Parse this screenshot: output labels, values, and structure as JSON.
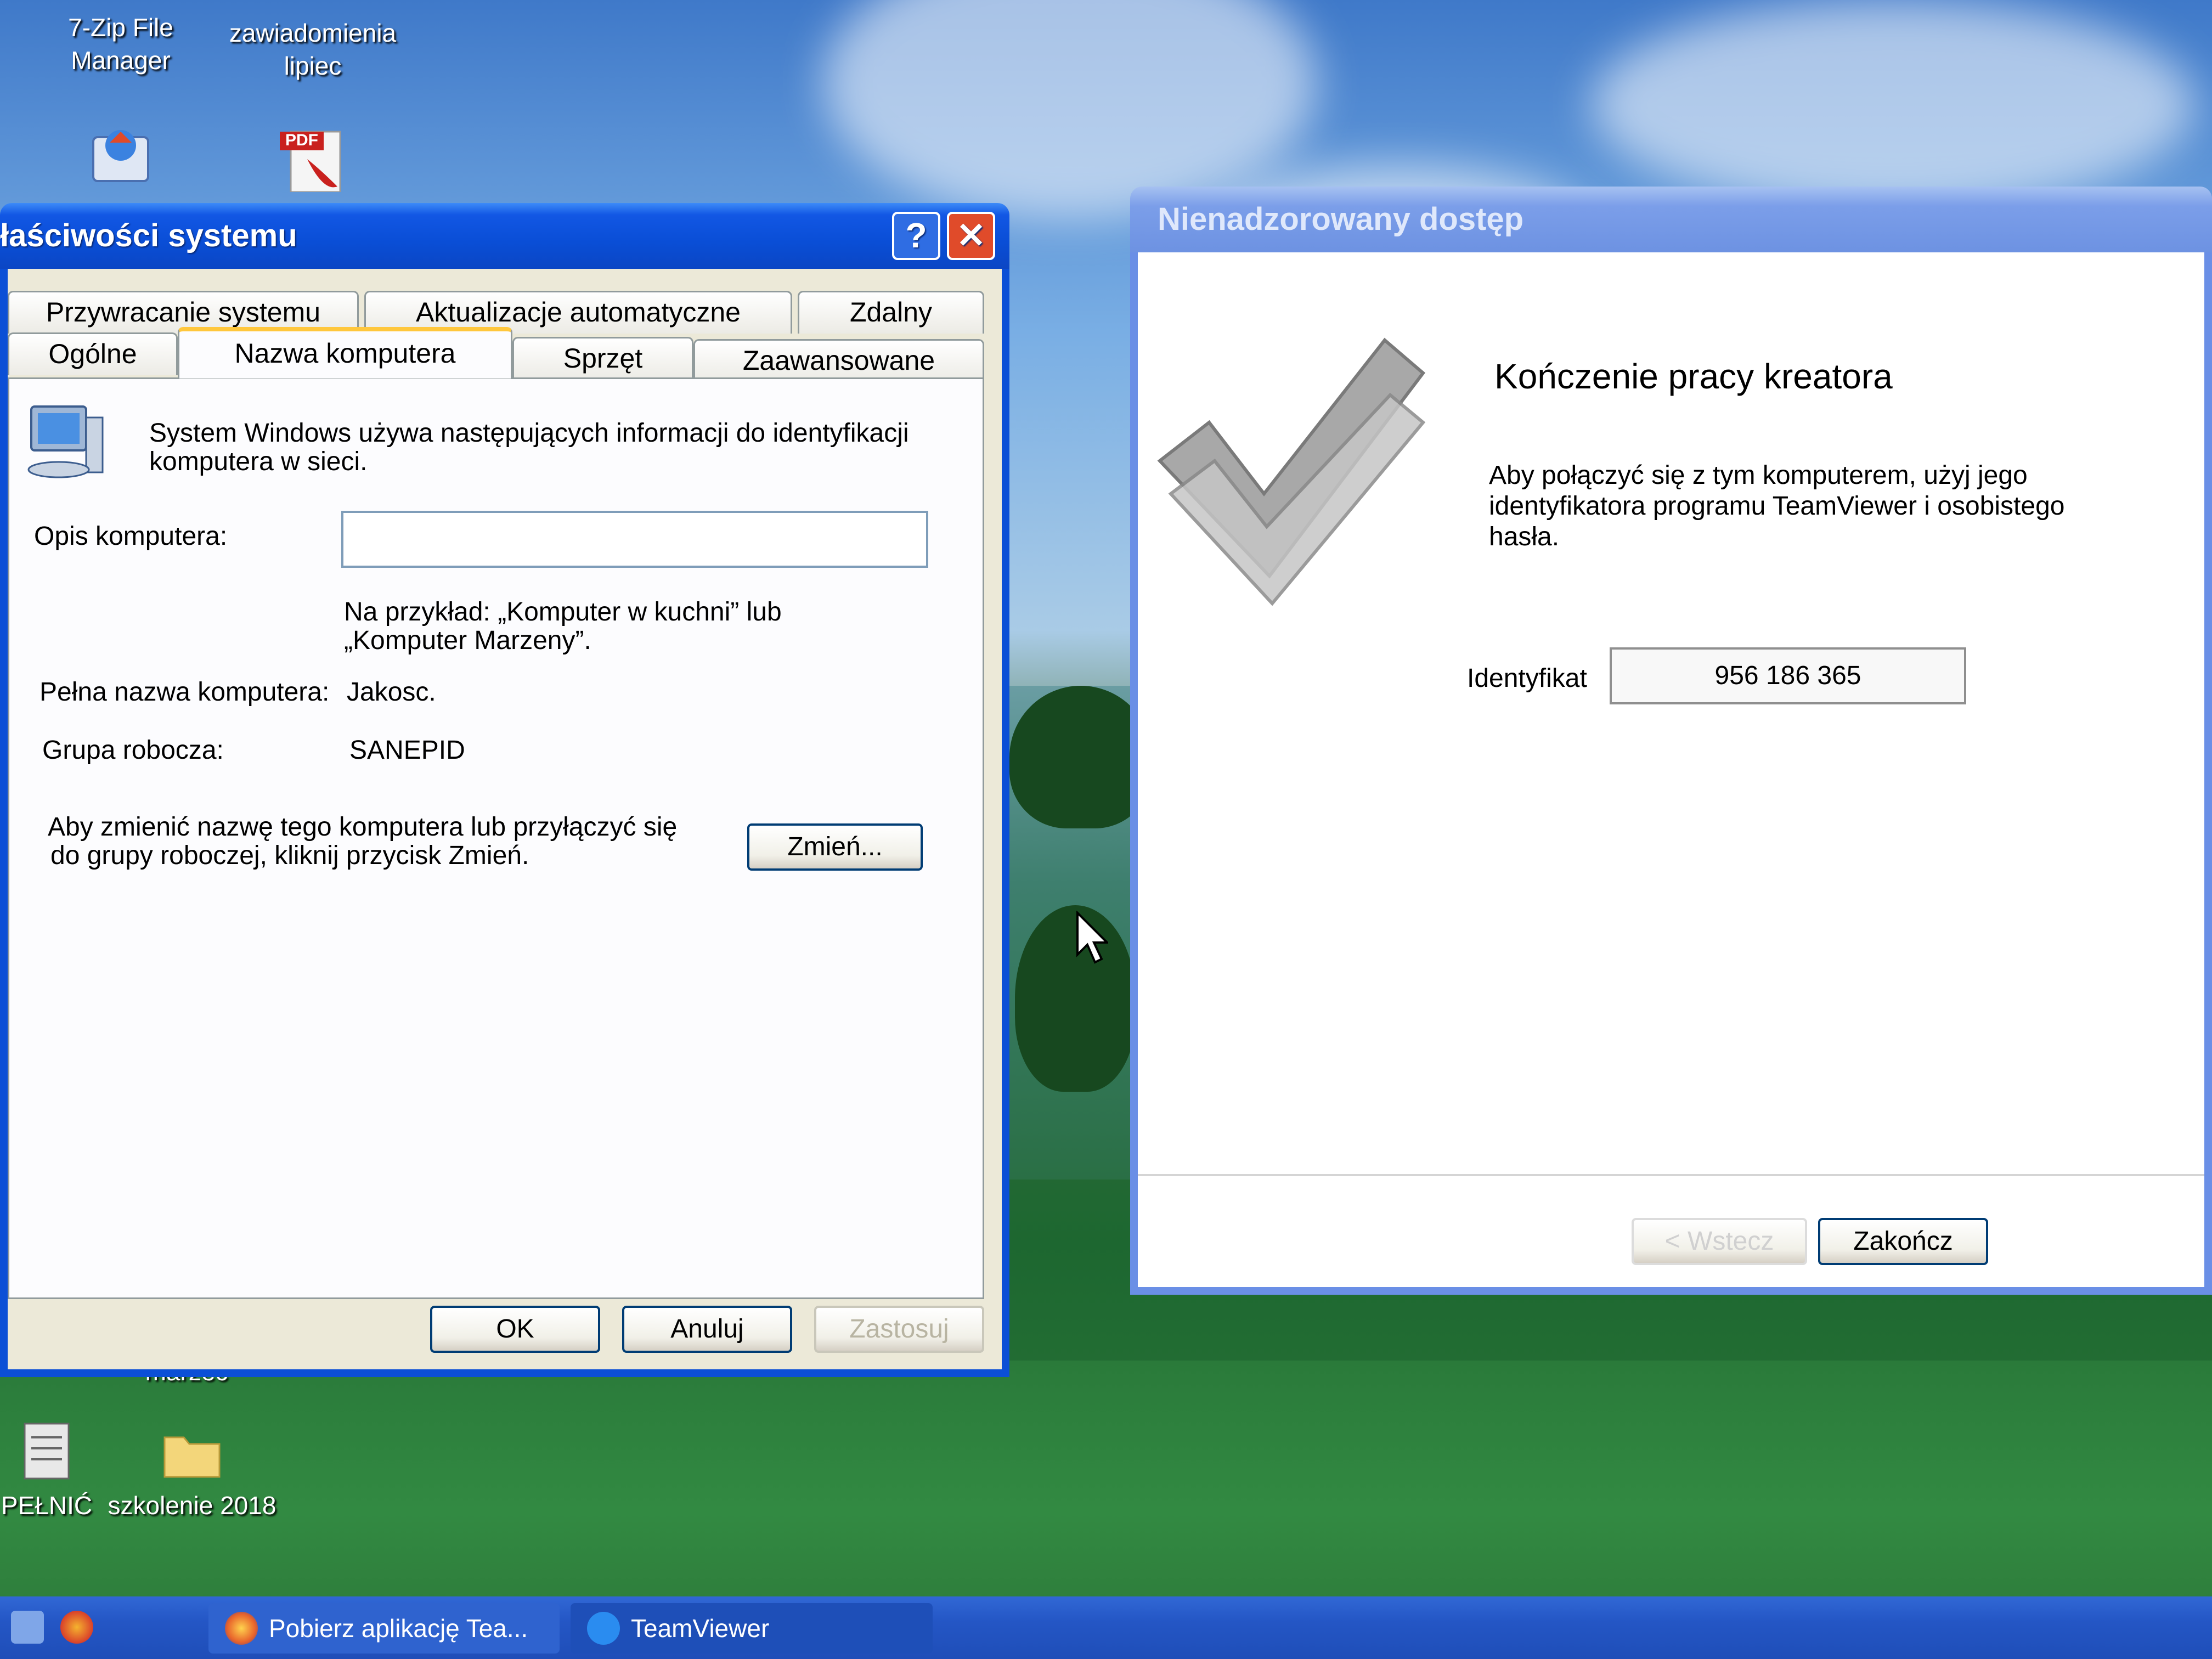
{
  "desktop": {
    "icons": [
      {
        "label_line1": "7-Zip File",
        "label_line2": "Manager"
      },
      {
        "label_line1": "zawiadomienia",
        "label_line2": "lipiec"
      },
      {
        "label": "marzec"
      },
      {
        "label": "PEŁNIĆ"
      },
      {
        "label": "szkolenie 2018"
      }
    ],
    "pdf_badge": "PDF"
  },
  "system_properties": {
    "title": "łaściwości systemu",
    "help_glyph": "?",
    "close_glyph": "✕",
    "tabs_row1": [
      "Przywracanie systemu",
      "Aktualizacje automatyczne",
      "Zdalny"
    ],
    "tabs_row2": [
      "Ogólne",
      "Nazwa komputera",
      "Sprzęt",
      "Zaawansowane"
    ],
    "active_tab": "Nazwa komputera",
    "intro_line1": "System Windows używa następujących informacji do identyfikacji",
    "intro_line2": "komputera w sieci.",
    "description_label": "Opis komputera:",
    "description_value": "",
    "example_line1": "Na przykład: „Komputer w kuchni” lub",
    "example_line2": "„Komputer Marzeny”.",
    "full_name_label": "Pełna nazwa komputera:",
    "full_name_value": "Jakosc.",
    "workgroup_label": "Grupa robocza:",
    "workgroup_value": "SANEPID",
    "change_text_line1": "Aby zmienić nazwę tego komputera lub przyłączyć się",
    "change_text_line2": "do grupy roboczej, kliknij przycisk Zmień.",
    "change_button": "Zmień...",
    "ok_button": "OK",
    "cancel_button": "Anuluj",
    "apply_button": "Zastosuj"
  },
  "wizard": {
    "title": "Nienadzorowany dostęp",
    "heading": "Kończenie pracy kreatora",
    "body_line1": "Aby połączyć się z tym komputerem, użyj jego",
    "body_line2": "identyfikatora programu TeamViewer i osobistego",
    "body_line3": "hasła.",
    "id_label": "Identyfikat",
    "id_value": "956 186 365",
    "back_button": "< Wstecz",
    "finish_button": "Zakończ"
  },
  "taskbar": {
    "items": [
      {
        "label": "Pobierz aplikację Tea..."
      },
      {
        "label": "TeamViewer"
      }
    ]
  },
  "colors": {
    "xp_blue": "#0b4fd6",
    "inactive_blue": "#6a8fe6",
    "window_face": "#ece9d8",
    "close_red": "#e04b2a",
    "tab_highlight": "#ffc73c"
  }
}
